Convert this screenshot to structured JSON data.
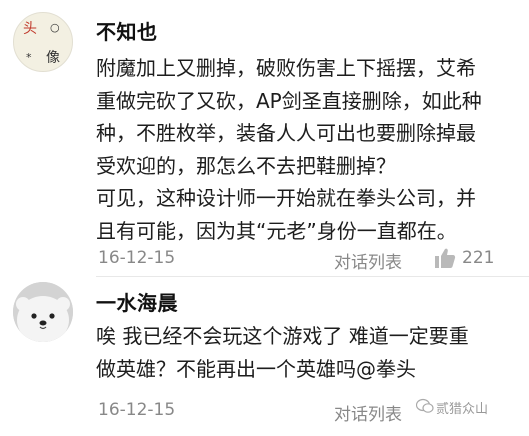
{
  "comments": [
    {
      "avatar_icon": "calligraphy-avatar",
      "avatar_chars": [
        "头",
        "像"
      ],
      "username": "不知也",
      "lines": [
        "附魔加上又删掉，破败伤害上下摇摆，艾希",
        "重做完砍了又砍，AP剑圣直接删除，如此种",
        "种，不胜枚举，装备人人可出也要删除掉最",
        "受欢迎的，那怎么不去把鞋删掉？",
        "可见，这种设计师一开始就在拳头公司，并",
        "且有可能，因为其“元老”身份一直都在。"
      ],
      "date": "16-12-15",
      "reply_label": "对话列表",
      "like_icon": "thumbs-up-icon",
      "like_count": "221"
    },
    {
      "avatar_icon": "ice-bear-avatar",
      "username": "一水海晨",
      "lines": [
        "唉 我已经不会玩这个游戏了 难道一定要重",
        "做英雄？不能再出一个英雄吗@拳头"
      ],
      "date": "16-12-15",
      "reply_label": "对话列表"
    }
  ],
  "watermark": {
    "text": "贰猎众山",
    "icon": "wechat-logo-icon"
  }
}
